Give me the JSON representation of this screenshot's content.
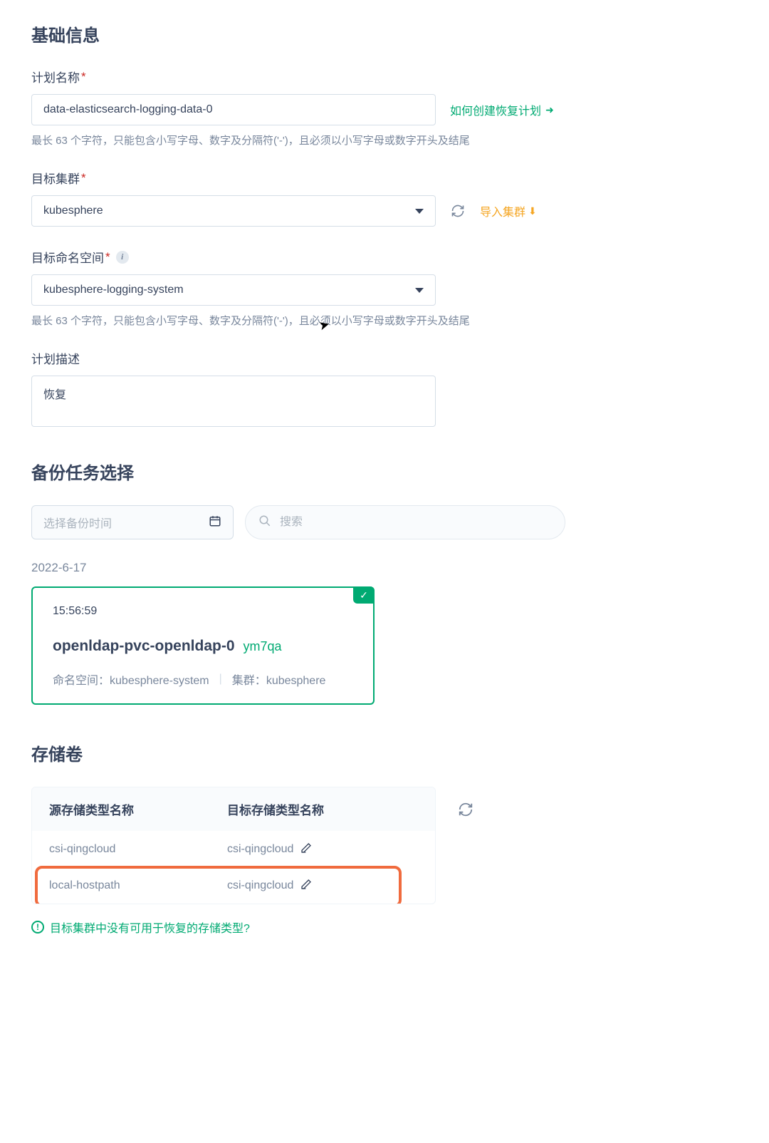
{
  "sections": {
    "basic_info_title": "基础信息",
    "backup_task_title": "备份任务选择",
    "storage_title": "存储卷"
  },
  "form": {
    "plan_name": {
      "label": "计划名称",
      "value": "data-elasticsearch-logging-data-0",
      "hint": "最长 63 个字符，只能包含小写字母、数字及分隔符('-')，且必须以小写字母或数字开头及结尾"
    },
    "target_cluster": {
      "label": "目标集群",
      "value": "kubesphere"
    },
    "target_namespace": {
      "label": "目标命名空间",
      "value": "kubesphere-logging-system",
      "hint": "最长 63 个字符，只能包含小写字母、数字及分隔符('-')，且必须以小写字母或数字开头及结尾"
    },
    "plan_desc": {
      "label": "计划描述",
      "value": "恢复"
    }
  },
  "links": {
    "how_to_create": "如何创建恢复计划",
    "import_cluster": "导入集群"
  },
  "backup_filter": {
    "date_placeholder": "选择备份时间",
    "search_placeholder": "搜索"
  },
  "backup_group_date": "2022-6-17",
  "backup_card": {
    "time": "15:56:59",
    "name": "openldap-pvc-openldap-0",
    "tag": "ym7qa",
    "namespace_label": "命名空间：",
    "namespace_value": "kubesphere-system",
    "cluster_label": "集群：",
    "cluster_value": "kubesphere"
  },
  "storage": {
    "header_source": "源存储类型名称",
    "header_target": "目标存储类型名称",
    "rows": [
      {
        "source": "csi-qingcloud",
        "target": "csi-qingcloud"
      },
      {
        "source": "local-hostpath",
        "target": "csi-qingcloud"
      }
    ],
    "warning": "目标集群中没有可用于恢复的存储类型?"
  }
}
